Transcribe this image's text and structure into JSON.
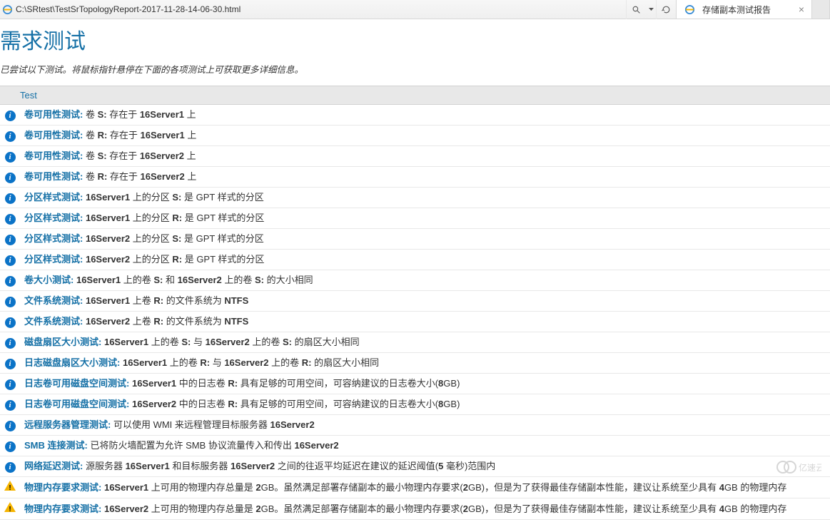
{
  "browser": {
    "url": "C:\\SRtest\\TestSrTopologyReport-2017-11-28-14-06-30.html",
    "tab_title": "存储副本测试报告"
  },
  "page": {
    "title": "需求测试",
    "hint": "已尝试以下测试。将鼠标指针悬停在下面的各项测试上可获取更多详细信息。"
  },
  "table": {
    "header": "Test",
    "rows": [
      {
        "level": "info",
        "name": "卷可用性测试:",
        "text": "卷 <b>S:</b> 存在于 <b>16Server1</b> 上"
      },
      {
        "level": "info",
        "name": "卷可用性测试:",
        "text": "卷 <b>R:</b> 存在于 <b>16Server1</b> 上"
      },
      {
        "level": "info",
        "name": "卷可用性测试:",
        "text": "卷 <b>S:</b> 存在于 <b>16Server2</b> 上"
      },
      {
        "level": "info",
        "name": "卷可用性测试:",
        "text": "卷 <b>R:</b> 存在于 <b>16Server2</b> 上"
      },
      {
        "level": "info",
        "name": "分区样式测试:",
        "text": "<b>16Server1</b> 上的分区 <b>S:</b> 是 GPT 样式的分区"
      },
      {
        "level": "info",
        "name": "分区样式测试:",
        "text": "<b>16Server1</b> 上的分区 <b>R:</b> 是 GPT 样式的分区"
      },
      {
        "level": "info",
        "name": "分区样式测试:",
        "text": "<b>16Server2</b> 上的分区 <b>S:</b> 是 GPT 样式的分区"
      },
      {
        "level": "info",
        "name": "分区样式测试:",
        "text": "<b>16Server2</b> 上的分区 <b>R:</b> 是 GPT 样式的分区"
      },
      {
        "level": "info",
        "name": "卷大小测试:",
        "text": "<b>16Server1</b> 上的卷 <b>S:</b> 和 <b>16Server2</b> 上的卷 <b>S:</b> 的大小相同"
      },
      {
        "level": "info",
        "name": "文件系统测试:",
        "text": "<b>16Server1</b> 上卷 <b>R:</b> 的文件系统为 <b>NTFS</b>"
      },
      {
        "level": "info",
        "name": "文件系统测试:",
        "text": "<b>16Server2</b> 上卷 <b>R:</b> 的文件系统为 <b>NTFS</b>"
      },
      {
        "level": "info",
        "name": "磁盘扇区大小测试:",
        "text": "<b>16Server1</b> 上的卷 <b>S:</b> 与 <b>16Server2</b> 上的卷 <b>S:</b> 的扇区大小相同"
      },
      {
        "level": "info",
        "name": "日志磁盘扇区大小测试:",
        "text": "<b>16Server1</b> 上的卷 <b>R:</b> 与 <b>16Server2</b> 上的卷 <b>R:</b> 的扇区大小相同"
      },
      {
        "level": "info",
        "name": "日志卷可用磁盘空间测试:",
        "text": "<b>16Server1</b> 中的日志卷 <b>R:</b> 具有足够的可用空间，可容纳建议的日志卷大小(<b>8</b>GB)"
      },
      {
        "level": "info",
        "name": "日志卷可用磁盘空间测试:",
        "text": "<b>16Server2</b> 中的日志卷 <b>R:</b> 具有足够的可用空间，可容纳建议的日志卷大小(<b>8</b>GB)"
      },
      {
        "level": "info",
        "name": "远程服务器管理测试:",
        "text": "可以使用 WMI 来远程管理目标服务器 <b>16Server2</b>"
      },
      {
        "level": "info",
        "name": "SMB 连接测试:",
        "text": "已将防火墙配置为允许 SMB 协议流量传入和传出 <b>16Server2</b>"
      },
      {
        "level": "info",
        "name": "网络延迟测试:",
        "text": "源服务器 <b>16Server1</b> 和目标服务器 <b>16Server2</b> 之间的往返平均延迟在建议的延迟阈值(<b>5</b> 毫秒)范围内"
      },
      {
        "level": "warn",
        "name": "物理内存要求测试:",
        "text": "<b>16Server1</b> 上可用的物理内存总量是 <b>2</b>GB。虽然满足部署存储副本的最小物理内存要求(<b>2</b>GB)，但是为了获得最佳存储副本性能，建议让系统至少具有 <b>4</b>GB 的物理内存"
      },
      {
        "level": "warn",
        "name": "物理内存要求测试:",
        "text": "<b>16Server2</b> 上可用的物理内存总量是 <b>2</b>GB。虽然满足部署存储副本的最小物理内存要求(<b>2</b>GB)，但是为了获得最佳存储副本性能，建议让系统至少具有 <b>4</b>GB 的物理内存"
      }
    ]
  },
  "watermark": "亿速云"
}
